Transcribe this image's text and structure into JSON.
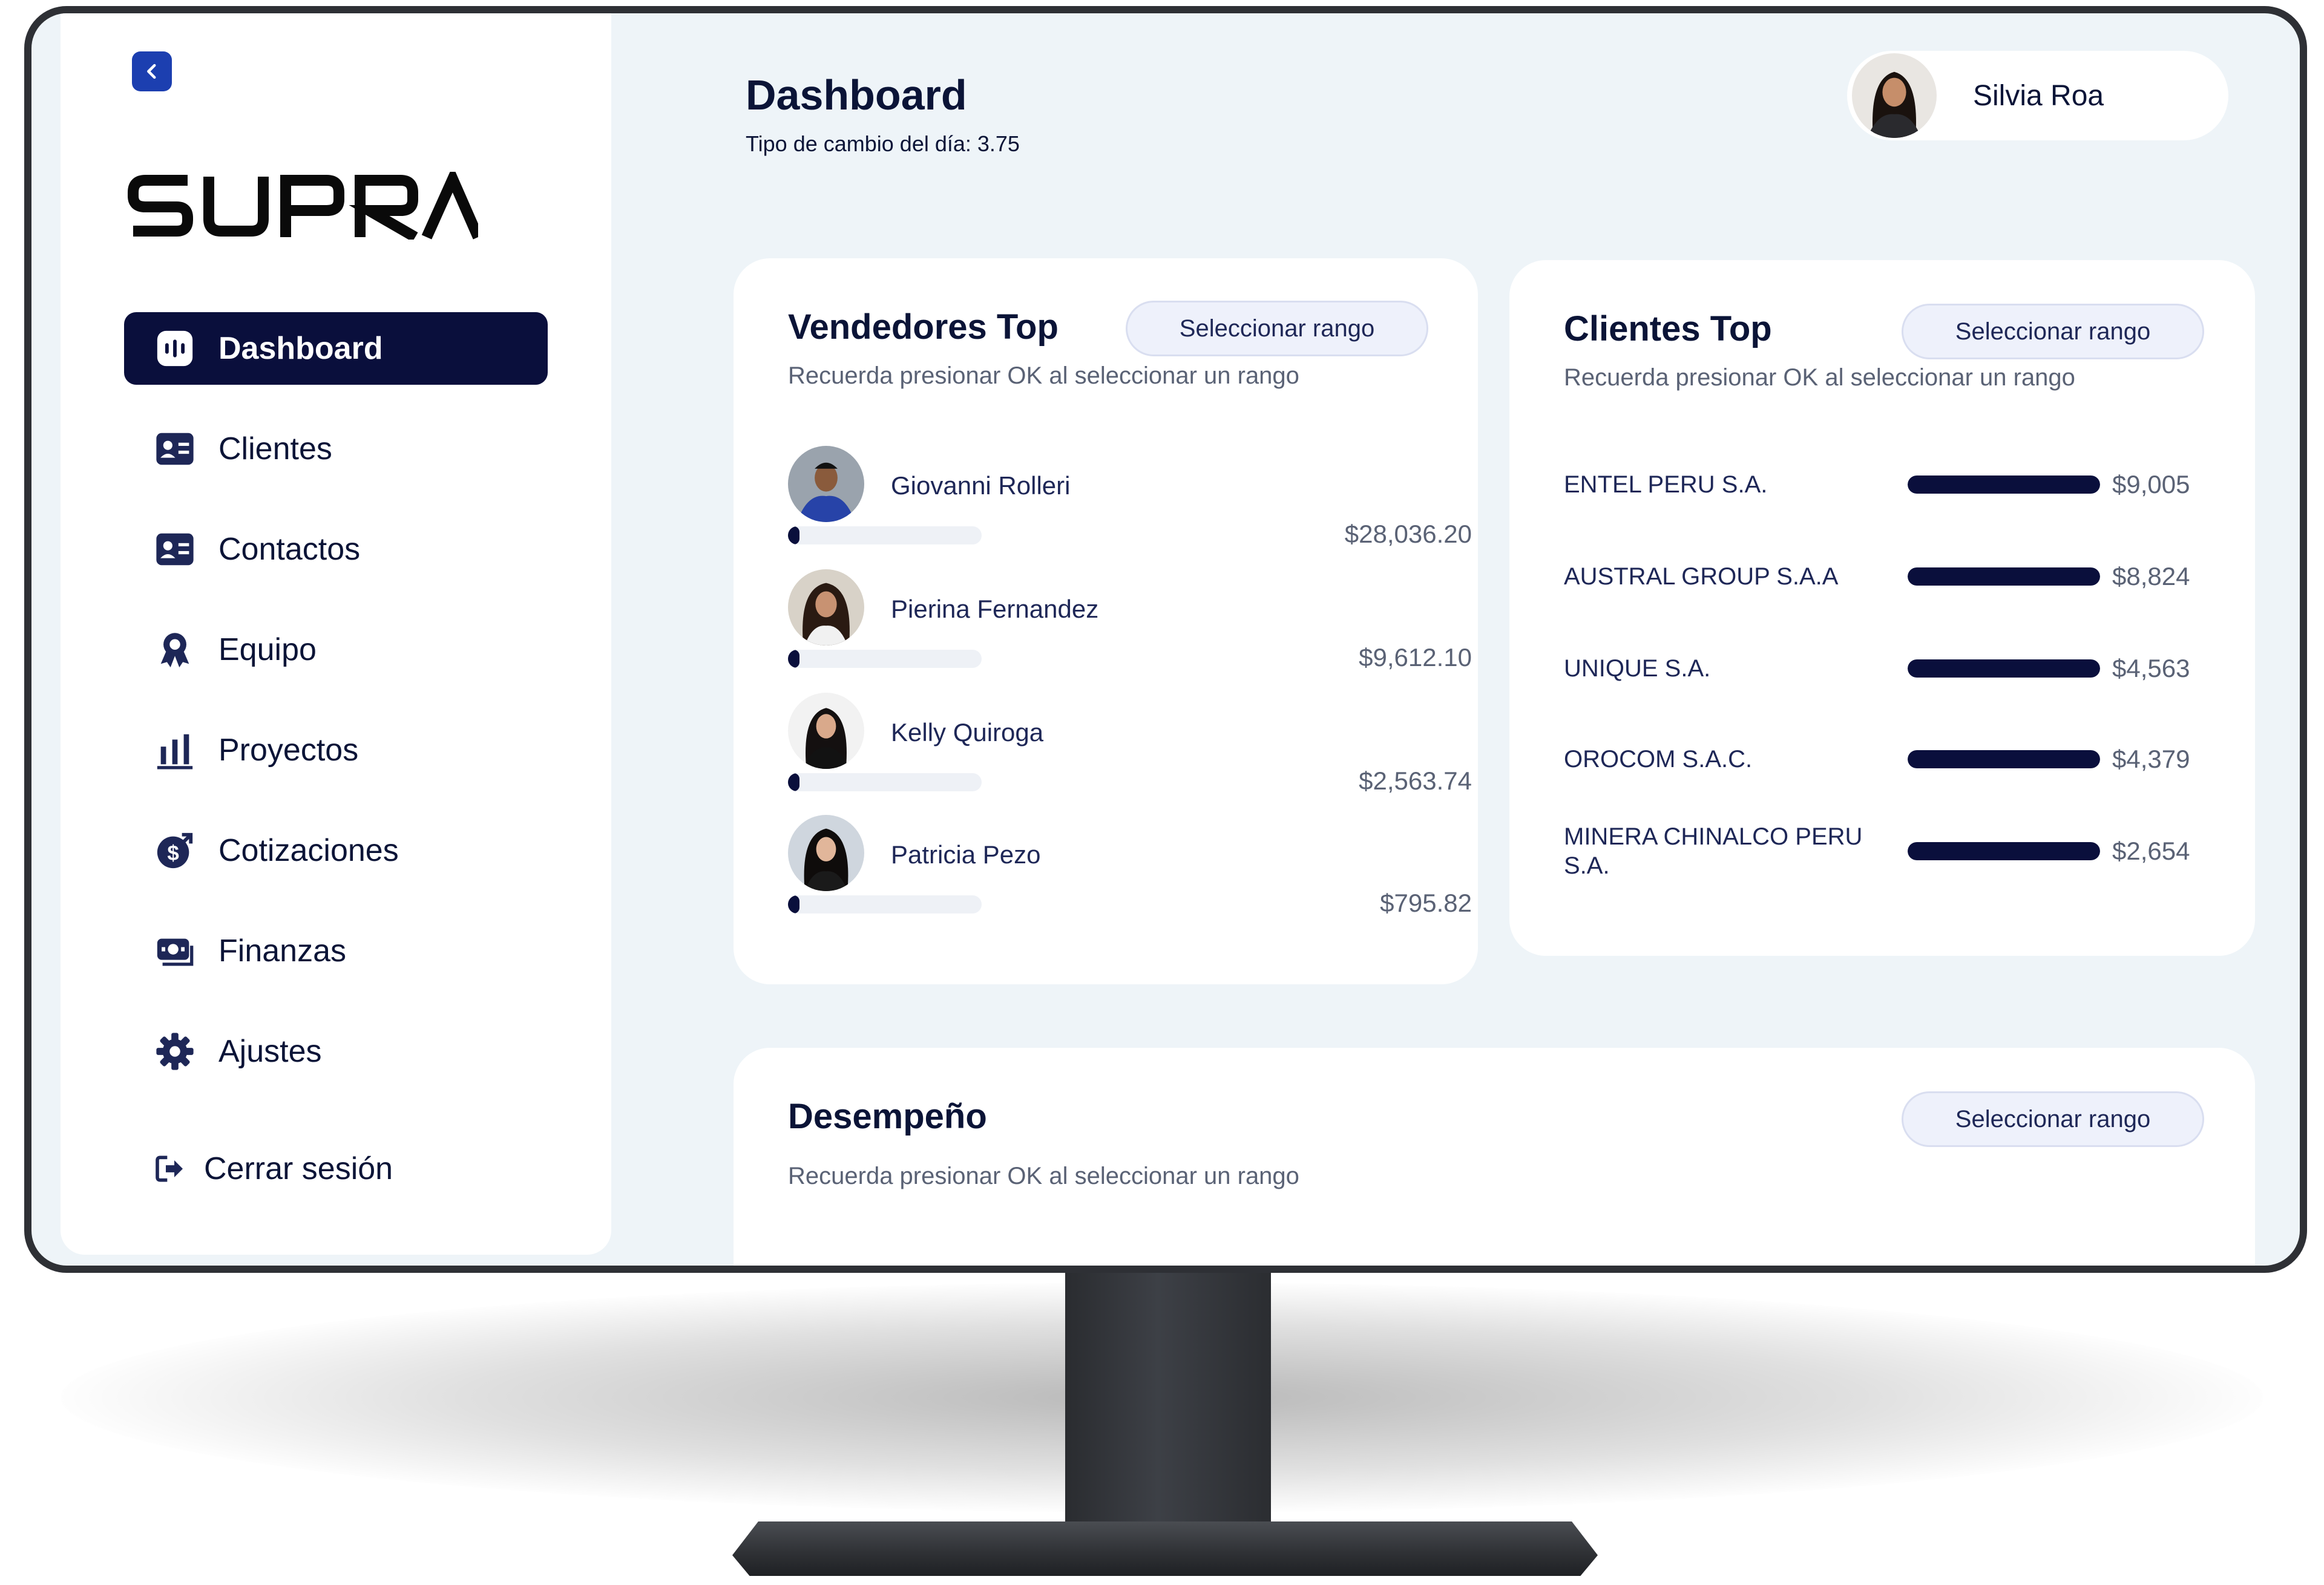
{
  "app": {
    "logo_text": "SUPRA"
  },
  "sidebar": {
    "collapse_icon": "chevron-left-icon",
    "items": [
      {
        "label": "Dashboard",
        "icon": "dashboard-icon",
        "active": true
      },
      {
        "label": "Clientes",
        "icon": "contact-card-icon"
      },
      {
        "label": "Contactos",
        "icon": "contact-card-icon"
      },
      {
        "label": "Equipo",
        "icon": "award-icon"
      },
      {
        "label": "Proyectos",
        "icon": "bar-chart-icon"
      },
      {
        "label": "Cotizaciones",
        "icon": "dollar-coin-icon"
      },
      {
        "label": "Finanzas",
        "icon": "money-icon"
      },
      {
        "label": "Ajustes",
        "icon": "gear-icon"
      }
    ],
    "logout": {
      "label": "Cerrar sesión",
      "icon": "logout-icon"
    }
  },
  "header": {
    "title": "Dashboard",
    "exchange_rate": "Tipo de cambio del día: 3.75",
    "user": {
      "name": "Silvia Roa"
    }
  },
  "vendedores": {
    "title": "Vendedores Top",
    "range_label": "Seleccionar rango",
    "hint": "Recuerda presionar OK al seleccionar un rango",
    "items": [
      {
        "name": "Giovanni Rolleri",
        "amount": "$28,036.20",
        "progress": 0.06
      },
      {
        "name": "Pierina Fernandez",
        "amount": "$9,612.10",
        "progress": 0.06
      },
      {
        "name": "Kelly Quiroga",
        "amount": "$2,563.74",
        "progress": 0.06
      },
      {
        "name": "Patricia Pezo",
        "amount": "$795.82",
        "progress": 0.06
      }
    ]
  },
  "clientes": {
    "title": "Clientes Top",
    "range_label": "Seleccionar rango",
    "hint": "Recuerda presionar OK al seleccionar un rango",
    "items": [
      {
        "name": "ENTEL PERU S.A.",
        "amount": "$9,005",
        "progress": 1.0
      },
      {
        "name": "AUSTRAL GROUP S.A.A",
        "amount": "$8,824",
        "progress": 1.0
      },
      {
        "name": "UNIQUE S.A.",
        "amount": "$4,563",
        "progress": 1.0
      },
      {
        "name": "OROCOM S.A.C.",
        "amount": "$4,379",
        "progress": 1.0
      },
      {
        "name": "MINERA CHINALCO PERU S.A.",
        "amount": "$2,654",
        "progress": 1.0
      }
    ]
  },
  "desempeno": {
    "title": "Desempeño",
    "range_label": "Seleccionar rango",
    "hint": "Recuerda presionar OK al seleccionar un rango"
  }
}
